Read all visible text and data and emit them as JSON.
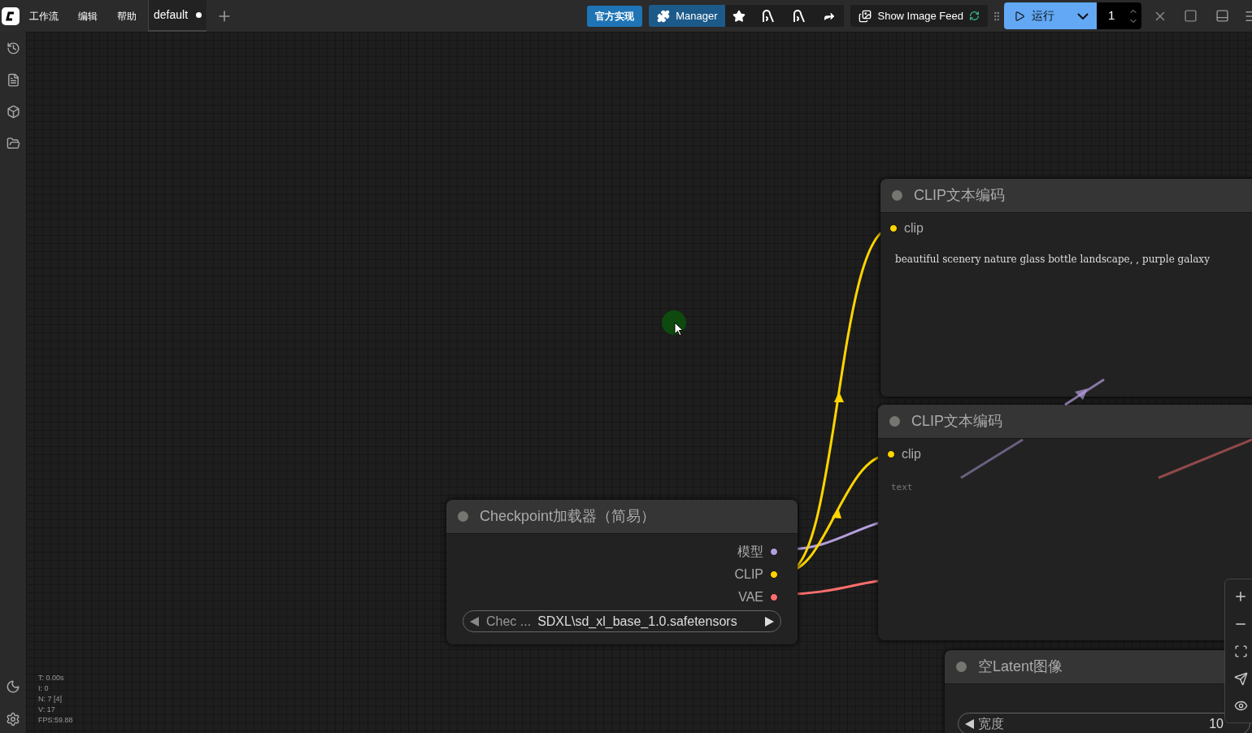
{
  "menu": [
    "工作流",
    "编辑",
    "帮助"
  ],
  "workflow_tab": {
    "label": "default",
    "modified": true,
    "selected": true
  },
  "official_button": "官方实现",
  "manager_button": "Manager",
  "image_feed_button": "Show Image Feed",
  "run_button": "运行",
  "batch_count": "1",
  "nodes": [
    {
      "kind": "text_encode",
      "title": "CLIP文本编码",
      "inputs": [
        {
          "label": "clip",
          "color": "#ffd500"
        }
      ],
      "value": "beautiful scenery nature glass bottle landscape, , purple galaxy"
    },
    {
      "kind": "text_encode",
      "title": "CLIP文本编码",
      "inputs": [
        {
          "label": "clip",
          "color": "#ffd500"
        }
      ],
      "placeholder": "text"
    },
    {
      "kind": "checkpoint",
      "title": "Checkpoint加载器（简易）",
      "outputs": [
        {
          "label": "模型",
          "color": "#b39ddb"
        },
        {
          "label": "CLIP",
          "color": "#ffd500"
        },
        {
          "label": "VAE",
          "color": "#ff6e6e"
        }
      ],
      "combo": {
        "label": "Chec ...",
        "value": "SDXL\\sd_xl_base_1.0.safetensors"
      }
    },
    {
      "kind": "latent",
      "title": "空Latent图像",
      "number": {
        "label": "宽度",
        "value": "10"
      }
    }
  ],
  "stats": [
    "T: 0.00s",
    "I: 0",
    "N: 7 [4]",
    "V: 17",
    "FPS:59.88"
  ]
}
